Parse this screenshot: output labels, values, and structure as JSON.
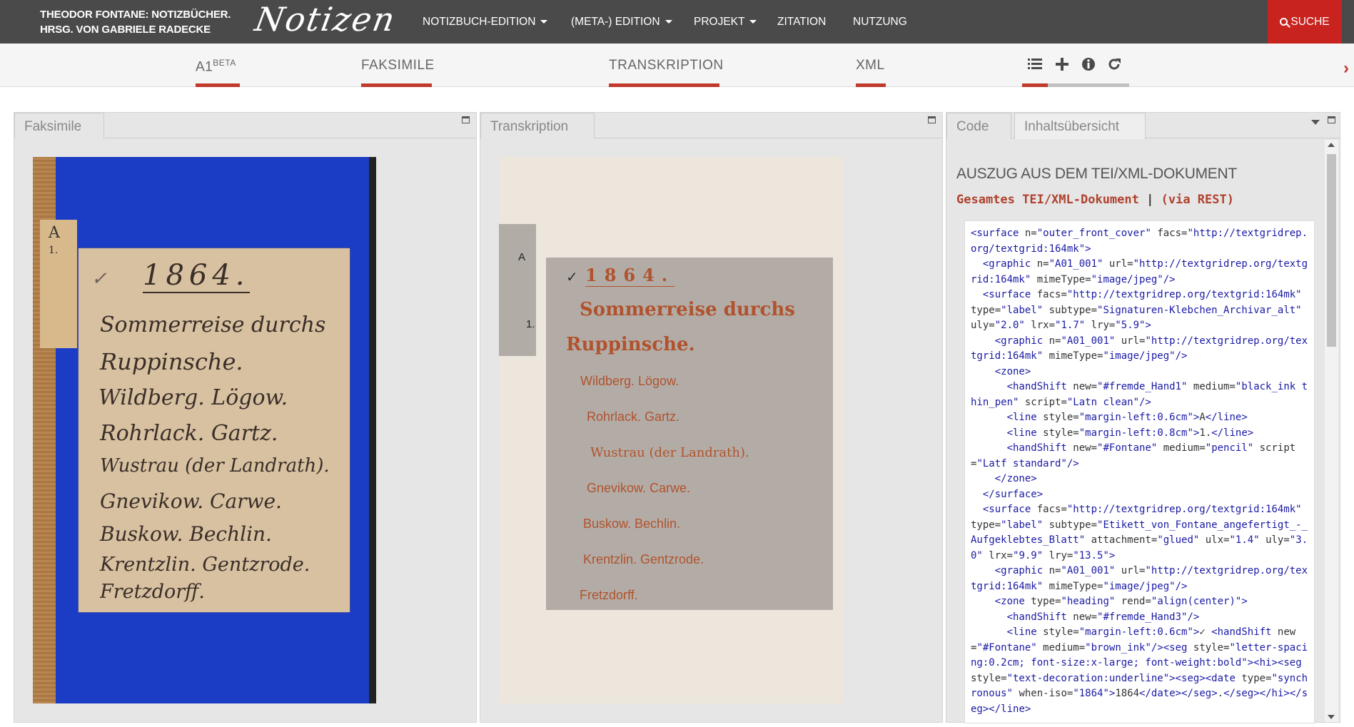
{
  "header": {
    "brand_line1": "THEODOR FONTANE: NOTIZBÜCHER.",
    "brand_line2": "HRSG. VON GABRIELE RADECKE",
    "logo_text": "Notizen",
    "nav": [
      {
        "label": "NOTIZBUCH-EDITION"
      },
      {
        "label": "(META-) EDITION"
      },
      {
        "label": "PROJEKT"
      },
      {
        "label": "ZITATION"
      },
      {
        "label": "NUTZUNG"
      }
    ],
    "search_label": "SUCHE"
  },
  "subnav": {
    "notebook": "A1",
    "notebook_sup": "BETA",
    "tabs": [
      "FAKSIMILE",
      "TRANSKRIPTION",
      "XML"
    ],
    "tools": [
      "list-icon",
      "plus-icon",
      "info-icon",
      "refresh-icon"
    ]
  },
  "faksimile": {
    "tab_label": "Faksimile",
    "sig_a": "A",
    "sig_1": "1.",
    "handwriting": [
      "1864.",
      "Sommerreise durchs",
      "Ruppinsche.",
      "Wildberg. Lögow.",
      "Rohrlack. Gartz.",
      "Wustrau (der Landrath).",
      "Gnevikow. Carwe.",
      "Buskow. Bechlin.",
      "Krentzlin. Gentzrode.",
      "Fretzdorff."
    ]
  },
  "transkription": {
    "tab_label": "Transkription",
    "sig_a": "A",
    "sig_1": "1.",
    "check": "✓",
    "year": "1864.",
    "title1": "Sommerreise durchs",
    "title2": "Ruppinsche.",
    "places": [
      "Wildberg. Lögow.",
      "Rohrlack. Gartz.",
      "Wustrau (der Landrath).",
      "Gnevikow. Carwe.",
      "Buskow. Bechlin.",
      "Krentzlin. Gentzrode.",
      "Fretzdorff."
    ]
  },
  "code": {
    "tab_code": "Code",
    "tab_inhalt": "Inhaltsübersicht",
    "heading": "AUSZUG AUS DEM TEI/XML-DOKUMENT",
    "link_full": "Gesamtes TEI/XML-Dokument",
    "separator": "|",
    "link_rest": "(via REST)",
    "xml": "<surface n=\"outer_front_cover\" facs=\"http://textgridrep.org/textgrid:164mk\">\n  <graphic n=\"A01_001\" url=\"http://textgridrep.org/textgrid:164mk\" mimeType=\"image/jpeg\"/>\n  <surface facs=\"http://textgridrep.org/textgrid:164mk\" type=\"label\" subtype=\"Signaturen-Klebchen_Archivar_alt\" uly=\"2.0\" lrx=\"1.7\" lry=\"5.9\">\n    <graphic n=\"A01_001\" url=\"http://textgridrep.org/textgrid:164mk\" mimeType=\"image/jpeg\"/>\n    <zone>\n      <handShift new=\"#fremde_Hand1\" medium=\"black_ink thin_pen\" script=\"Latn clean\"/>\n      <line style=\"margin-left:0.6cm\">A</line>\n      <line style=\"margin-left:0.8cm\">1.</line>\n      <handShift new=\"#Fontane\" medium=\"pencil\" script=\"Latf standard\"/>\n    </zone>\n  </surface>\n  <surface facs=\"http://textgridrep.org/textgrid:164mk\" type=\"label\" subtype=\"Etikett_von_Fontane_angefertigt_-_Aufgeklebtes_Blatt\" attachment=\"glued\" ulx=\"1.4\" uly=\"3.0\" lrx=\"9.9\" lry=\"13.5\">\n    <graphic n=\"A01_001\" url=\"http://textgridrep.org/textgrid:164mk\" mimeType=\"image/jpeg\"/>\n    <zone type=\"heading\" rend=\"align(center)\">\n      <handShift new=\"#fremde_Hand3\"/>\n      <line style=\"margin-left:0.6cm\">✓ <handShift new=\"#Fontane\" medium=\"brown_ink\"/><seg style=\"letter-spacing:0.2cm; font-size:x-large; font-weight:bold\"><hi><seg style=\"text-decoration:underline\"><seg><date type=\"synchronous\" when-iso=\"1864\">1864</date></seg>.</seg></hi></seg></line>"
  }
}
